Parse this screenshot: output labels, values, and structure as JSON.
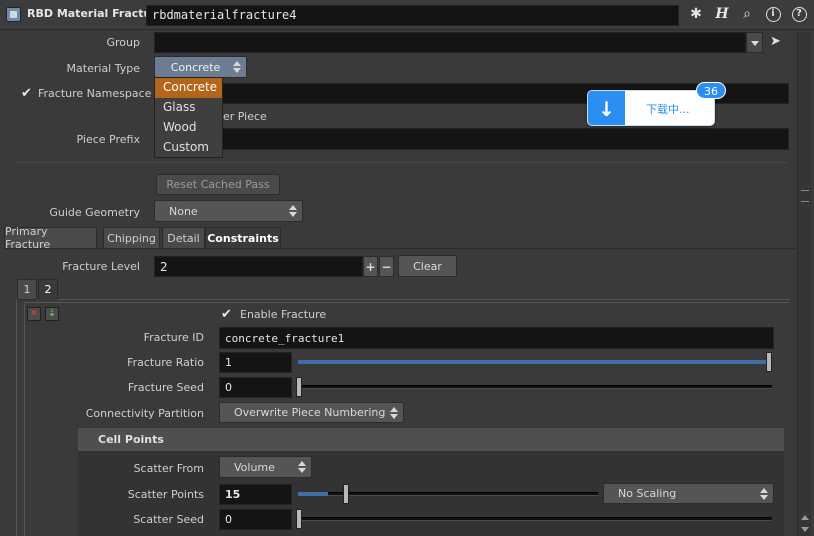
{
  "header": {
    "node_type": "RBD Material Fracture",
    "node_name": "rbdmaterialfracture4"
  },
  "params": {
    "group_label": "Group",
    "group_value": "",
    "material_type_label": "Material Type",
    "material_type_value": "Concrete",
    "material_options": [
      "Concrete",
      "Glass",
      "Wood",
      "Custom"
    ],
    "fracture_namespace_label": "Fracture Namespace",
    "fracture_namespace_checked": true,
    "per_piece_partial": "per Piece",
    "piece_prefix_label": "Piece Prefix",
    "reset_cached_pass_label": "Reset Cached Pass",
    "guide_geometry_label": "Guide Geometry",
    "guide_geometry_value": "None"
  },
  "tabs": [
    "Primary Fracture",
    "Chipping",
    "Detail",
    "Constraints"
  ],
  "active_tab": "Constraints",
  "fracture": {
    "level_label": "Fracture Level",
    "level_value": "2",
    "plus": "+",
    "minus": "−",
    "clear_label": "Clear",
    "subtabs": [
      "1",
      "2"
    ],
    "enable_label": "Enable Fracture",
    "id_label": "Fracture ID",
    "id_value": "concrete_fracture1",
    "ratio_label": "Fracture Ratio",
    "ratio_value": "1",
    "ratio_fraction": 1.0,
    "seed_label": "Fracture Seed",
    "seed_value": "0",
    "seed_fraction": 0.0,
    "connectivity_label": "Connectivity Partition",
    "connectivity_value": "Overwrite Piece Numbering"
  },
  "cell_points": {
    "heading": "Cell Points",
    "scatter_from_label": "Scatter From",
    "scatter_from_value": "Volume",
    "scatter_points_label": "Scatter Points",
    "scatter_points_value": "15",
    "scatter_points_fraction": 0.1,
    "scaling_value": "No Scaling",
    "scatter_seed_label": "Scatter Seed",
    "scatter_seed_value": "0"
  },
  "download_widget": {
    "text": "下载中...",
    "badge": "36"
  },
  "colors": {
    "accent_blue": "#3e6fa7",
    "dropdown_highlight": "#b3651a",
    "download_blue": "#2a8ff0"
  }
}
